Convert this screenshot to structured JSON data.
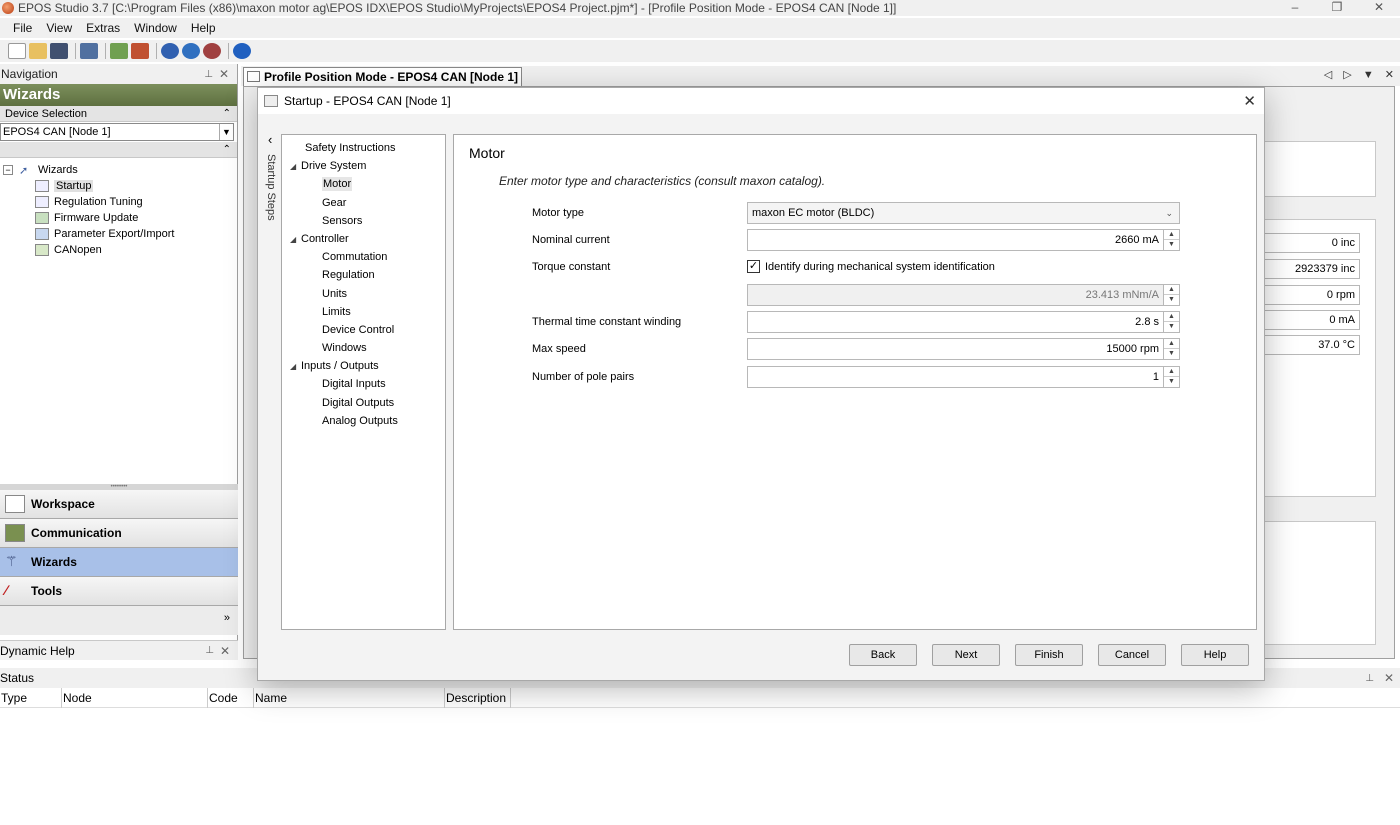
{
  "window": {
    "title": "EPOS Studio 3.7 [C:\\Program Files (x86)\\maxon motor ag\\EPOS IDX\\EPOS Studio\\MyProjects\\EPOS4 Project.pjm*] - [Profile Position Mode - EPOS4 CAN [Node 1]]",
    "minimize": "–",
    "restore": "❐",
    "close": "✕"
  },
  "menu": [
    "File",
    "View",
    "Extras",
    "Window",
    "Help"
  ],
  "navigation": {
    "header": "Navigation",
    "pin": "⊥",
    "close": "✕",
    "wizards_title": "Wizards",
    "device_selection_label": "Device Selection",
    "device_value": "EPOS4 CAN [Node 1]",
    "tree_root": "Wizards",
    "tree_items": [
      "Startup",
      "Regulation Tuning",
      "Firmware Update",
      "Parameter Export/Import",
      "CANopen"
    ],
    "buttons": [
      "Workspace",
      "Communication",
      "Wizards",
      "Tools"
    ],
    "overflow": "»"
  },
  "dynamic_help": {
    "label": "Dynamic Help"
  },
  "status": {
    "label": "Status",
    "columns": [
      "Type",
      "Node",
      "Code",
      "Name",
      "Description"
    ]
  },
  "document": {
    "tab_title": "Profile Position Mode - EPOS4 CAN [Node 1]",
    "background_values": [
      "0 inc",
      "2923379 inc",
      "0 rpm",
      "0 mA",
      "37.0 °C"
    ]
  },
  "dialog": {
    "title": "Startup - EPOS4 CAN [Node 1]",
    "collapse_chevron": "‹",
    "steps_label": "Startup Steps",
    "steps": {
      "safety": "Safety Instructions",
      "drive_system": "Drive System",
      "drive_items": [
        "Motor",
        "Gear",
        "Sensors"
      ],
      "controller": "Controller",
      "controller_items": [
        "Commutation",
        "Regulation",
        "Units",
        "Limits",
        "Device Control",
        "Windows"
      ],
      "io": "Inputs / Outputs",
      "io_items": [
        "Digital Inputs",
        "Digital Outputs",
        "Analog Outputs"
      ]
    },
    "content": {
      "heading": "Motor",
      "subtitle": "Enter motor type and characteristics (consult maxon catalog).",
      "motor_type_label": "Motor type",
      "motor_type_value": "maxon EC motor (BLDC)",
      "nominal_current_label": "Nominal current",
      "nominal_current_value": "2660 mA",
      "torque_constant_label": "Torque constant",
      "identify_checkbox_label": "Identify during mechanical system identification",
      "torque_constant_value": "23.413 mNm/A",
      "thermal_label": "Thermal time constant winding",
      "thermal_value": "2.8 s",
      "max_speed_label": "Max speed",
      "max_speed_value": "15000 rpm",
      "pole_pairs_label": "Number of pole pairs",
      "pole_pairs_value": "1"
    },
    "buttons": {
      "back": "Back",
      "next": "Next",
      "finish": "Finish",
      "cancel": "Cancel",
      "help": "Help"
    }
  }
}
